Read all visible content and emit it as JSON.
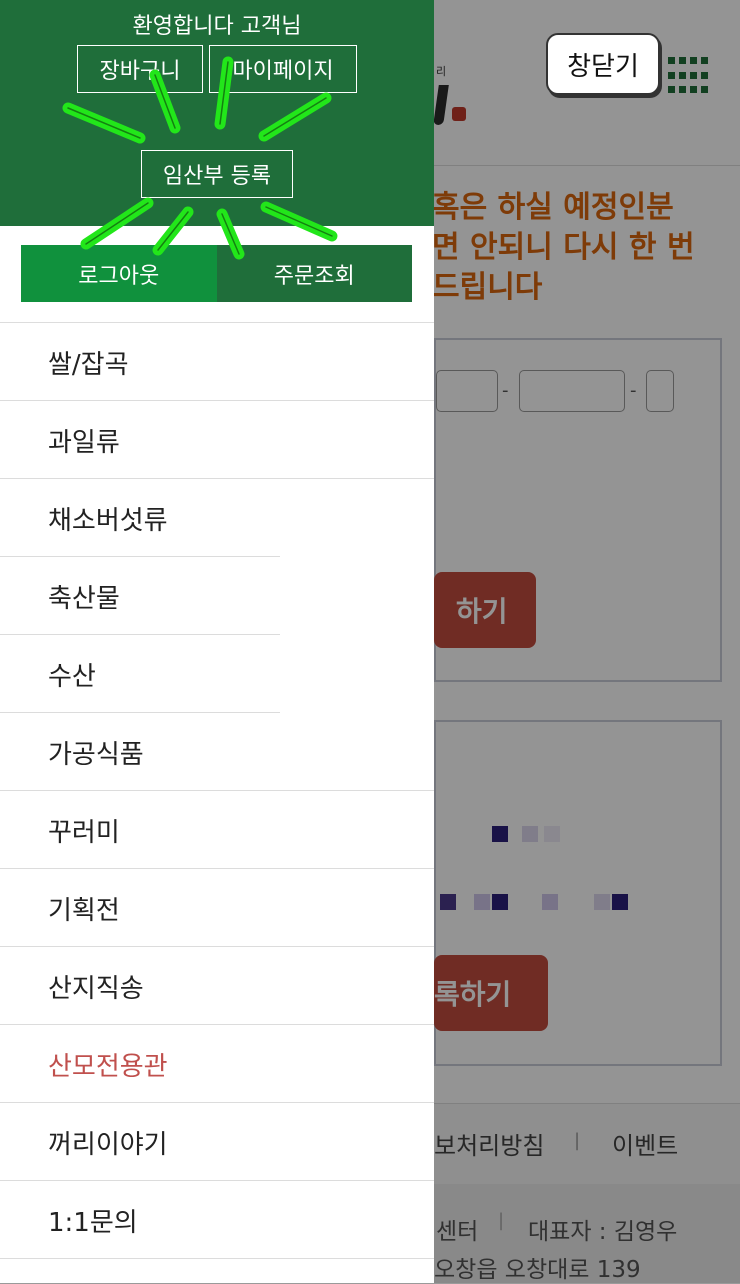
{
  "drawer": {
    "welcome": "환영합니다 고객님",
    "cart_label": "장바구니",
    "mypage_label": "마이페이지",
    "register_label": "임산부 등록",
    "logout_label": "로그아웃",
    "orders_label": "주문조회"
  },
  "menu": {
    "items": [
      {
        "label": "쌀/잡곡"
      },
      {
        "label": "과일류"
      },
      {
        "label": "채소버섯류"
      },
      {
        "label": "축산물"
      },
      {
        "label": "수산"
      },
      {
        "label": "가공식품"
      },
      {
        "label": "꾸러미"
      },
      {
        "label": "기획전"
      },
      {
        "label": "산지직송"
      },
      {
        "label": "산모전용관"
      },
      {
        "label": "꺼리이야기"
      },
      {
        "label": "1:1문의"
      }
    ]
  },
  "overlay": {
    "close_label": "창닫기"
  },
  "background": {
    "logo_small_text": "리",
    "warning_lines": [
      "혹은 하실 예정인분",
      "면 안되니 다시 한 번",
      "드립니다"
    ],
    "submit1_label": "하기",
    "submit2_label": "록하기",
    "footer_links": [
      "보처리방침",
      "이벤트"
    ],
    "footer_info": [
      "센터",
      "대표자 : 김영우",
      "오창읍 오창대로 139"
    ]
  },
  "colors": {
    "header_green": "#1f6e3a",
    "logout_green": "#10913d",
    "highlight_stroke": "#22e61a",
    "accent_red": "#c0504d",
    "warning_orange": "#d9660f"
  }
}
